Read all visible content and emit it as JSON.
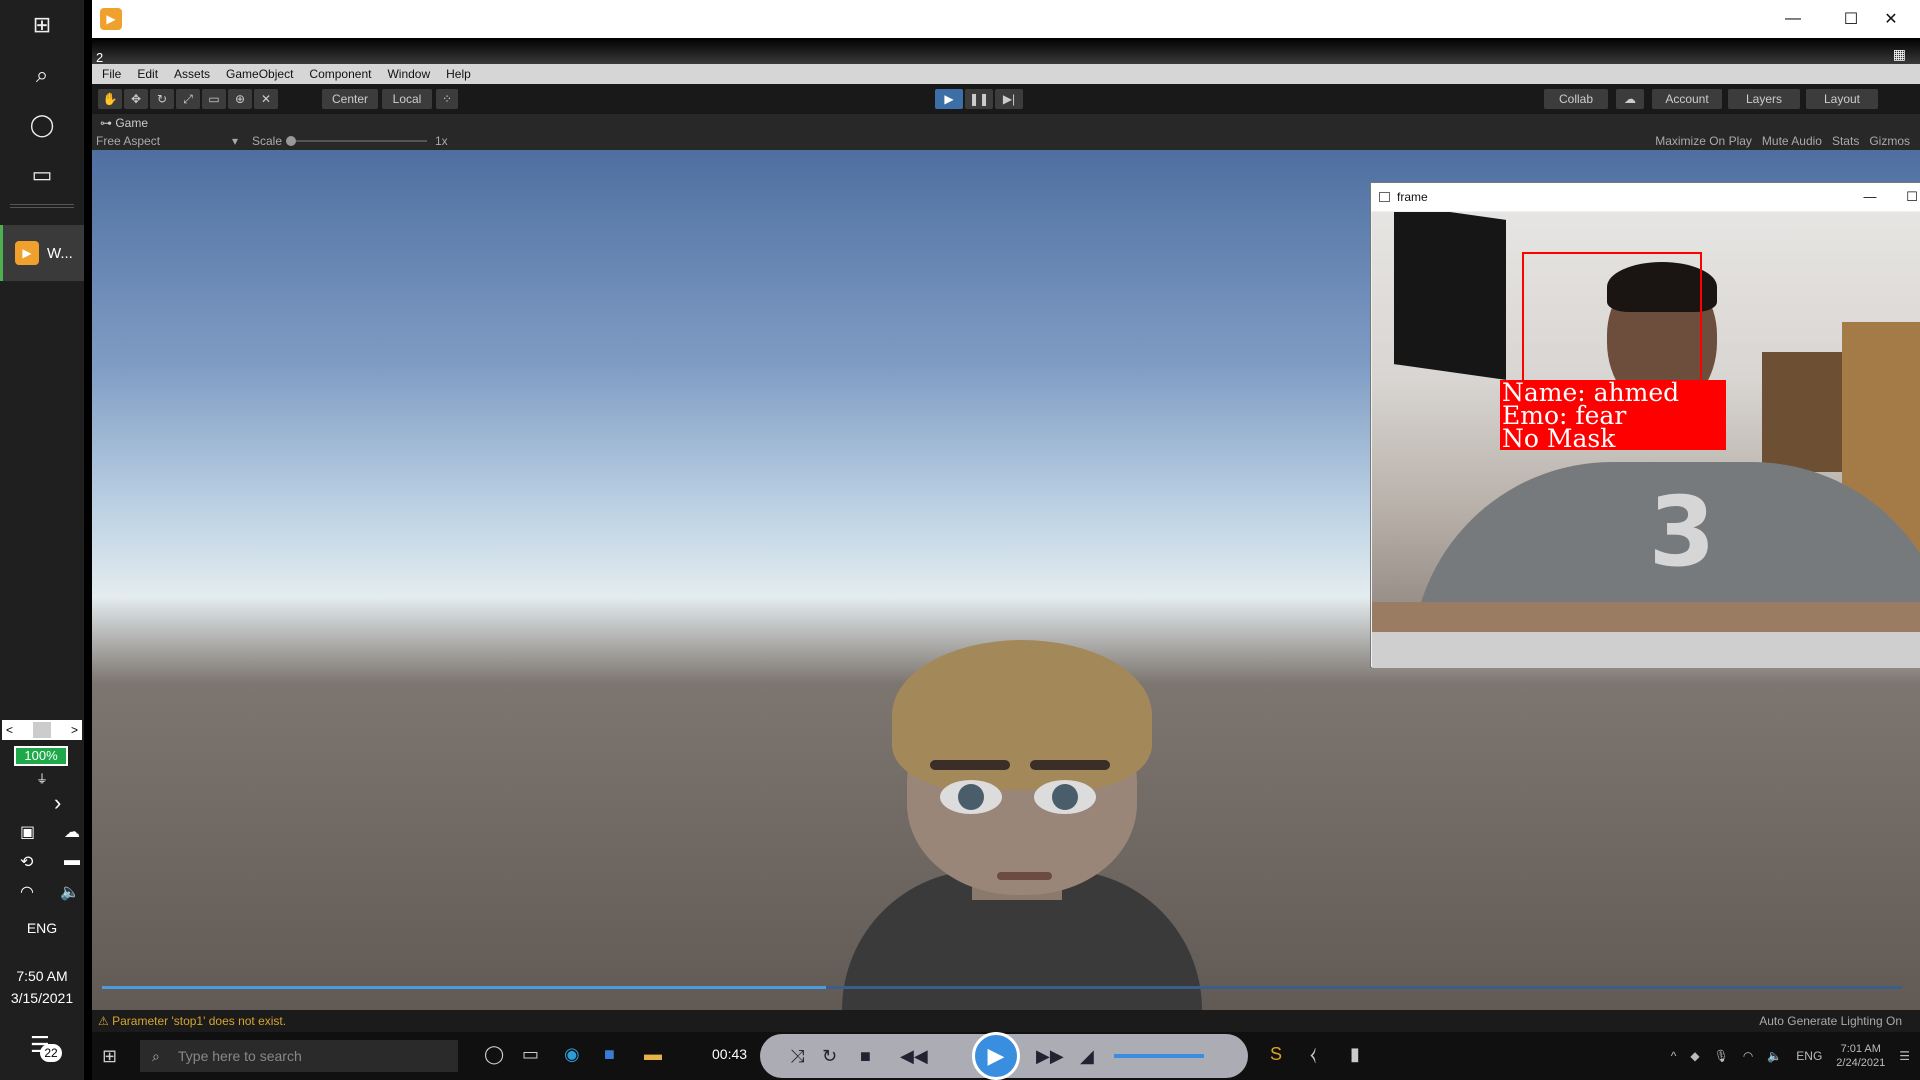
{
  "left_taskbar": {
    "app_label": "W...",
    "battery": "100%",
    "lang": "ENG",
    "time": "7:50 AM",
    "date": "3/15/2021",
    "notifications": "22"
  },
  "unity": {
    "title_num": "2",
    "menu": [
      "File",
      "Edit",
      "Assets",
      "GameObject",
      "Component",
      "Window",
      "Help"
    ],
    "toolbar": {
      "center": "Center",
      "local": "Local",
      "collab": "Collab",
      "account": "Account",
      "layers": "Layers",
      "layout": "Layout"
    },
    "game_tab": "Game",
    "aspect": "Free Aspect",
    "scale_label": "Scale",
    "scale_value": "1x",
    "right_controls": [
      "Maximize On Play",
      "Mute Audio",
      "Stats",
      "Gizmos"
    ],
    "status_warning": "Parameter 'stop1' does not exist.",
    "status_right": "Auto Generate Lighting On"
  },
  "frame_window": {
    "title": "frame",
    "label_lines": [
      "Name: ahmed",
      "Emo: fear",
      "No Mask"
    ],
    "shirt_number": "3"
  },
  "inner_taskbar": {
    "search_placeholder": "Type here to search",
    "media_time": "00:43",
    "lang": "ENG",
    "time": "7:01 AM",
    "date": "2/24/2021"
  },
  "colors": {
    "face_box": "#ff0000",
    "battery": "#1ea84a",
    "play_accent": "#3c6ea8",
    "warning_text": "#d6a531"
  }
}
